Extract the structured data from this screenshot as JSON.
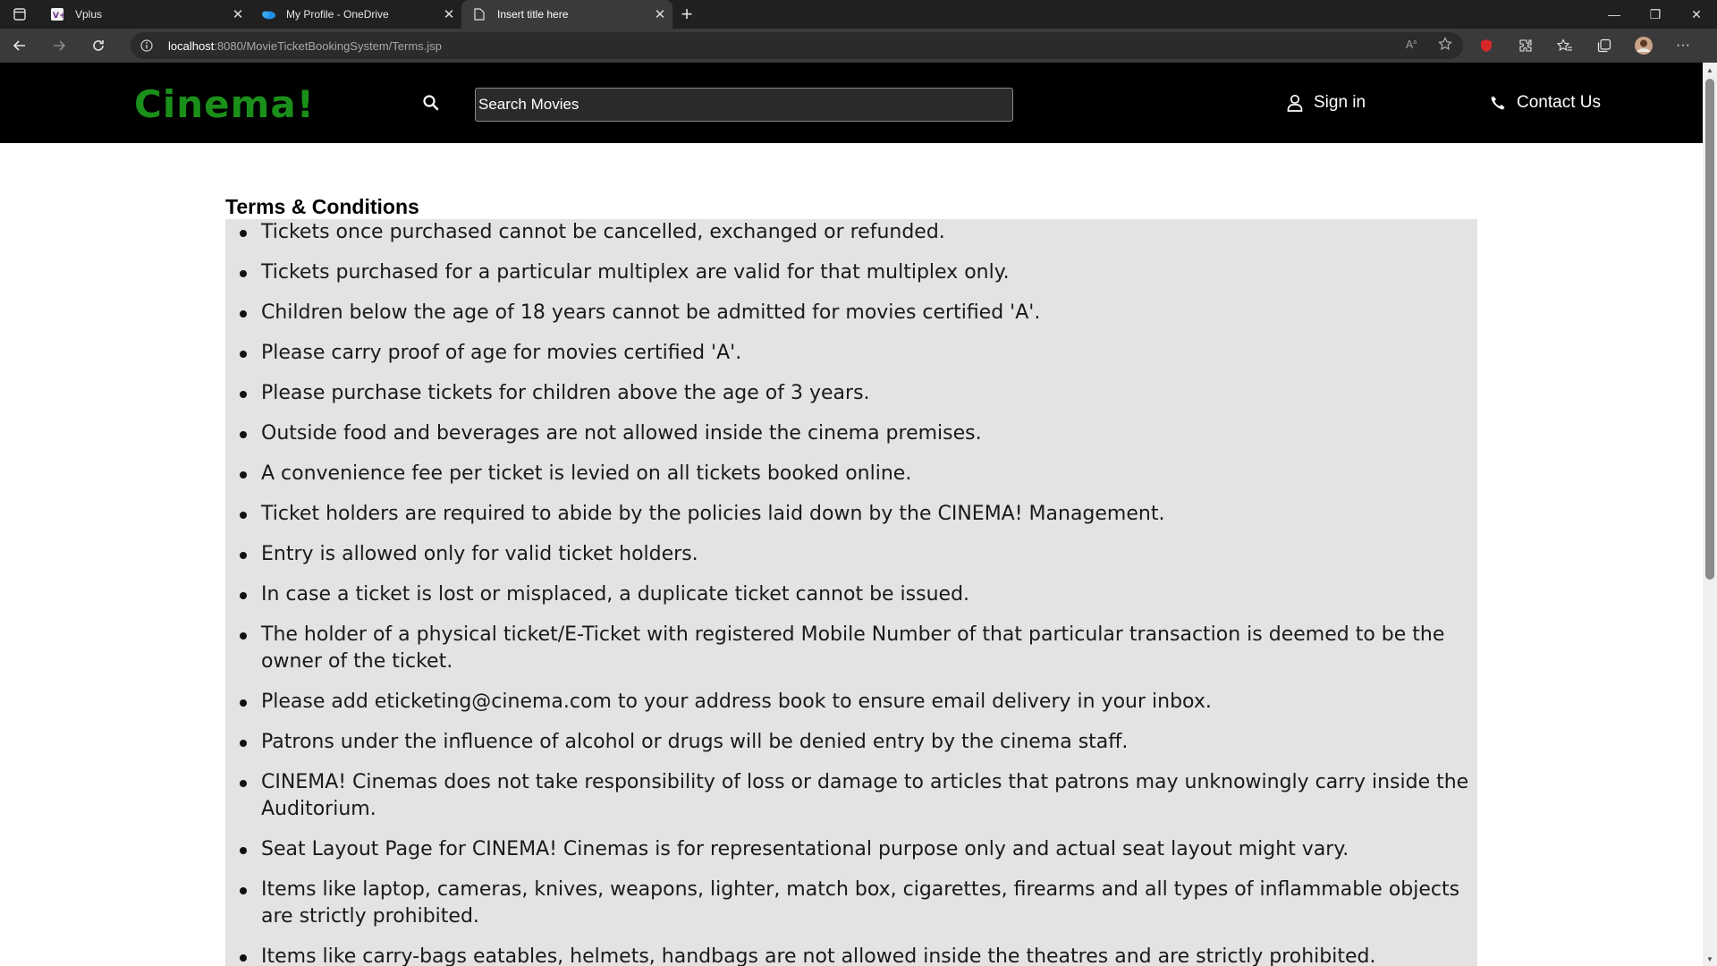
{
  "browser": {
    "tabs": [
      {
        "title": "Vplus",
        "favicon": "vplus-icon",
        "active": false
      },
      {
        "title": "My Profile - OneDrive",
        "favicon": "onedrive-icon",
        "active": false
      },
      {
        "title": "Insert title here",
        "favicon": "page-icon",
        "active": true
      }
    ],
    "url_host": "localhost",
    "url_rest": ":8080/MovieTicketBookingSystem/Terms.jsp"
  },
  "site": {
    "logo": "Cinema!",
    "search_placeholder": "Search Movies",
    "signin_label": "Sign in",
    "contact_label": "Contact Us",
    "brand_color": "#1a8f1a"
  },
  "terms": {
    "title": "Terms & Conditions",
    "items": [
      "Tickets once purchased cannot be cancelled, exchanged or refunded.",
      "Tickets purchased for a particular multiplex are valid for that multiplex only.",
      "Children below the age of 18 years cannot be admitted for movies certified 'A'.",
      "Please carry proof of age for movies certified 'A'.",
      "Please purchase tickets for children above the age of 3 years.",
      "Outside food and beverages are not allowed inside the cinema premises.",
      "A convenience fee per ticket is levied on all tickets booked online.",
      "Ticket holders are required to abide by the policies laid down by the CINEMA! Management.",
      "Entry is allowed only for valid ticket holders.",
      "In case a ticket is lost or misplaced, a duplicate ticket cannot be issued.",
      "The holder of a physical ticket/E-Ticket with registered Mobile Number of that particular transaction is deemed to be the owner of the ticket.",
      "Please add eticketing@cinema.com to your address book to ensure email delivery in your inbox.",
      "Patrons under the influence of alcohol or drugs will be denied entry by the cinema staff.",
      "CINEMA! Cinemas does not take responsibility of loss or damage to articles that patrons may unknowingly carry inside the Auditorium.",
      "Seat Layout Page for CINEMA! Cinemas is for representational purpose only and actual seat layout might vary.",
      "Items like laptop, cameras, knives, weapons, lighter, match box, cigarettes, firearms and all types of inflammable objects are strictly prohibited.",
      "Items like carry-bags eatables, helmets, handbags are not allowed inside the theatres and are strictly prohibited."
    ]
  }
}
